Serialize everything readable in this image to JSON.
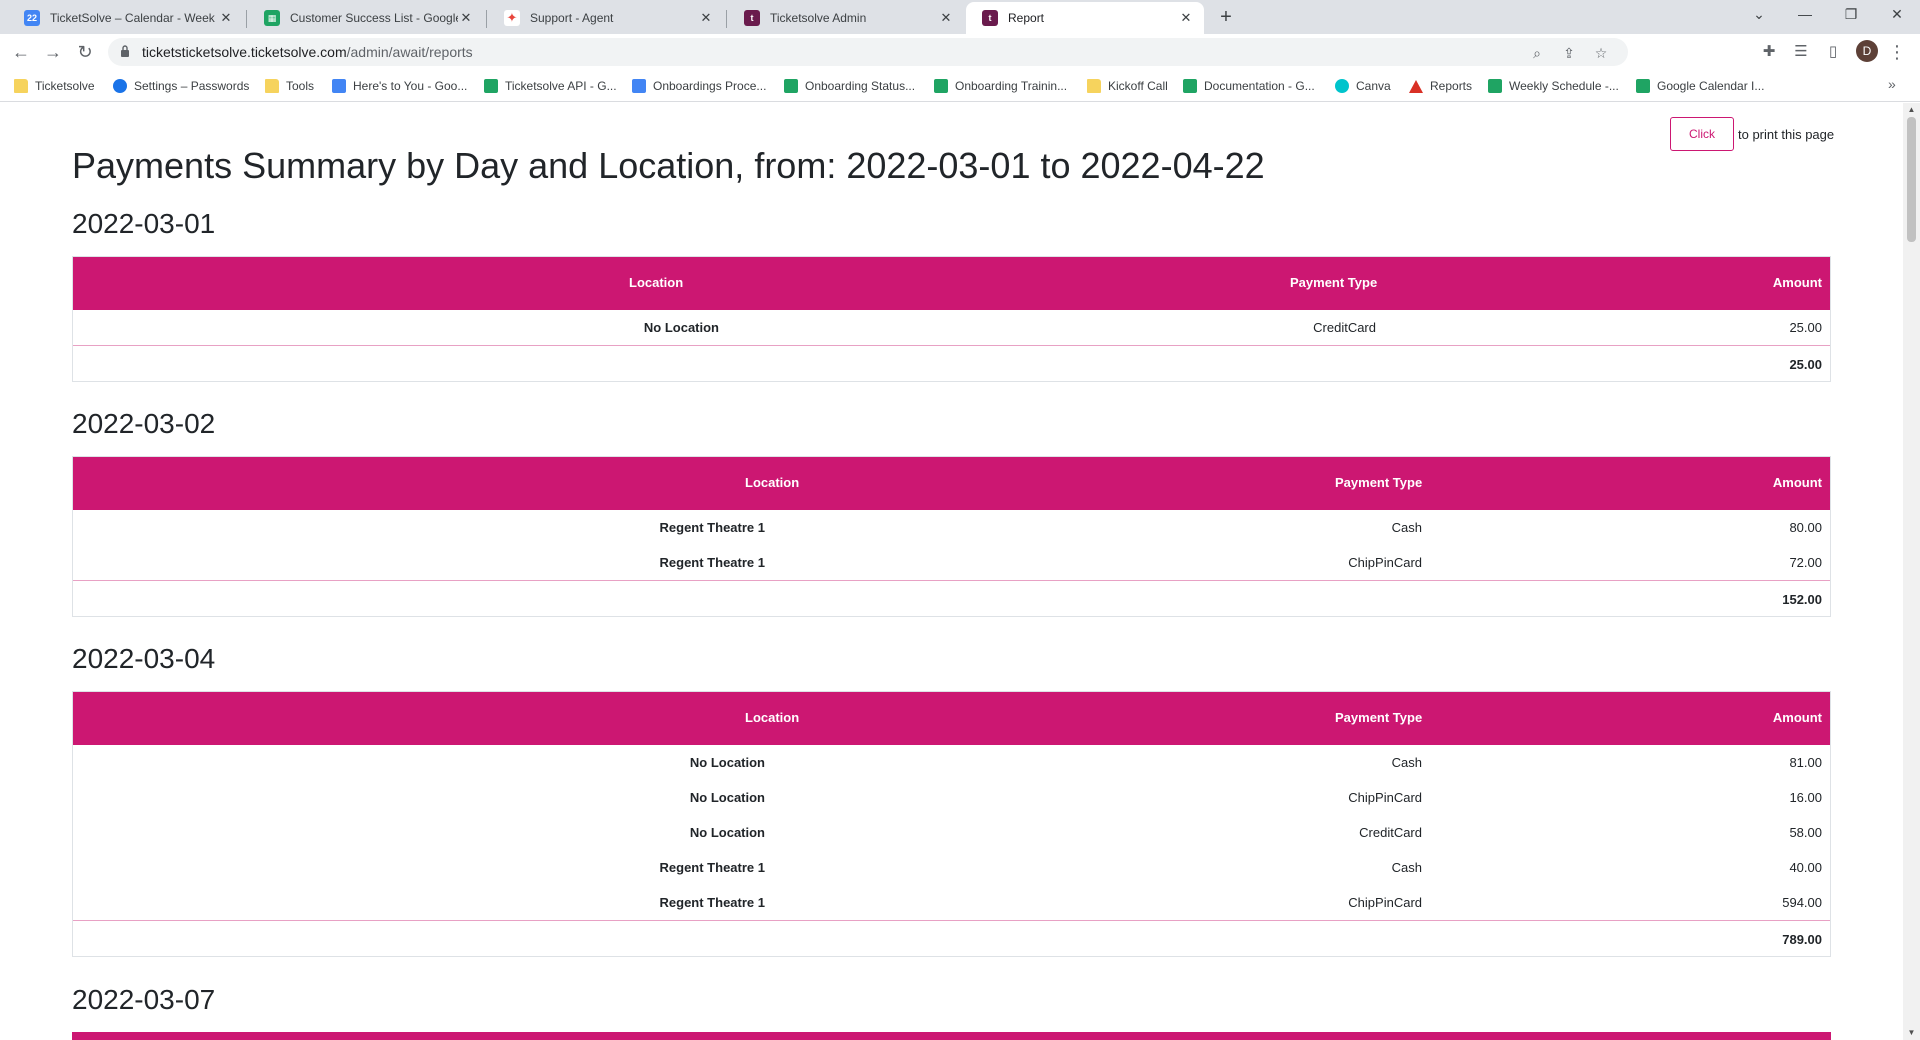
{
  "browser": {
    "tabs": [
      {
        "title": "TicketSolve – Calendar - Week of",
        "favicon": "calendar-icon",
        "color": "#4285f4",
        "active": false
      },
      {
        "title": "Customer Success List - Google S",
        "favicon": "sheets-icon",
        "color": "#1fa463",
        "active": false
      },
      {
        "title": "Support - Agent",
        "favicon": "support-icon",
        "color": "#e8453c",
        "active": false
      },
      {
        "title": "Ticketsolve Admin",
        "favicon": "ticketsolve-icon",
        "color": "#6a1b4d",
        "active": false
      },
      {
        "title": "Report",
        "favicon": "ticketsolve-icon",
        "color": "#6a1b4d",
        "active": true
      }
    ],
    "url_host": "ticketsticketsolve.ticketsolve.com",
    "url_path": "/admin/await/reports",
    "profile_initial": "D",
    "bookmarks": [
      {
        "label": "Ticketsolve",
        "icon": "folder"
      },
      {
        "label": "Settings – Passwords",
        "icon": "gear"
      },
      {
        "label": "Tools",
        "icon": "folder"
      },
      {
        "label": "Here's to You - Goo...",
        "icon": "doc"
      },
      {
        "label": "Ticketsolve API - G...",
        "icon": "sheet"
      },
      {
        "label": "Onboardings Proce...",
        "icon": "doc"
      },
      {
        "label": "Onboarding Status...",
        "icon": "sheet"
      },
      {
        "label": "Onboarding Trainin...",
        "icon": "sheet"
      },
      {
        "label": "Kickoff Call",
        "icon": "folder"
      },
      {
        "label": "Documentation - G...",
        "icon": "sheet"
      },
      {
        "label": "Canva",
        "icon": "canva"
      },
      {
        "label": "Reports",
        "icon": "reports"
      },
      {
        "label": "Weekly Schedule -...",
        "icon": "sheet"
      },
      {
        "label": "Google Calendar I...",
        "icon": "sheet"
      }
    ]
  },
  "page": {
    "print_button": "Click",
    "print_text": "to print this page",
    "title": "Payments Summary by Day and Location, from: 2022-03-01 to 2022-04-22",
    "columns": {
      "location": "Location",
      "payment_type": "Payment Type",
      "amount": "Amount"
    },
    "accent_color": "#cc1772",
    "days": [
      {
        "date": "2022-03-01",
        "rows": [
          {
            "location": "No Location",
            "payment_type": "CreditCard",
            "amount": "25.00"
          }
        ],
        "total": "25.00"
      },
      {
        "date": "2022-03-02",
        "rows": [
          {
            "location": "Regent Theatre 1",
            "payment_type": "Cash",
            "amount": "80.00"
          },
          {
            "location": "Regent Theatre 1",
            "payment_type": "ChipPinCard",
            "amount": "72.00"
          }
        ],
        "total": "152.00"
      },
      {
        "date": "2022-03-04",
        "rows": [
          {
            "location": "No Location",
            "payment_type": "Cash",
            "amount": "81.00"
          },
          {
            "location": "No Location",
            "payment_type": "ChipPinCard",
            "amount": "16.00"
          },
          {
            "location": "No Location",
            "payment_type": "CreditCard",
            "amount": "58.00"
          },
          {
            "location": "Regent Theatre 1",
            "payment_type": "Cash",
            "amount": "40.00"
          },
          {
            "location": "Regent Theatre 1",
            "payment_type": "ChipPinCard",
            "amount": "594.00"
          }
        ],
        "total": "789.00"
      },
      {
        "date": "2022-03-07",
        "rows": [],
        "total": ""
      }
    ]
  }
}
